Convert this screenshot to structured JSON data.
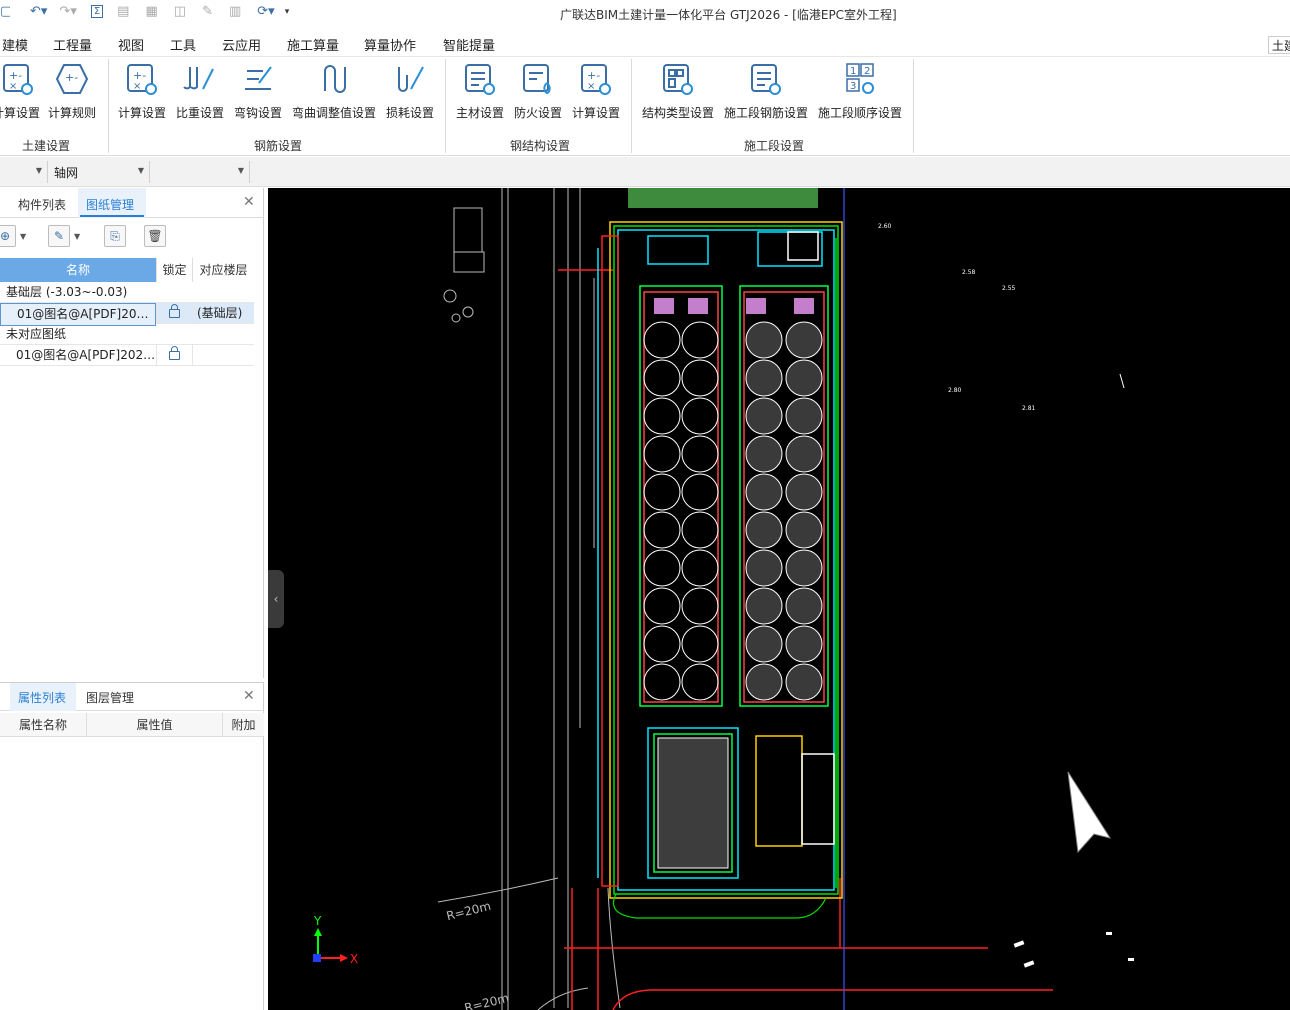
{
  "app": {
    "title": "广联达BIM土建计量一体化平台 GTJ2026 - [临港EPC室外工程]",
    "right_tab": "土建"
  },
  "menu": [
    "建模",
    "工程量",
    "视图",
    "工具",
    "云应用",
    "施工算量",
    "算量协作",
    "智能提量"
  ],
  "ribbon": {
    "groups": [
      {
        "label": "土建设置",
        "items": [
          "计算设置",
          "计算规则"
        ]
      },
      {
        "label": "钢筋设置",
        "items": [
          "计算设置",
          "比重设置",
          "弯钩设置",
          "弯曲调整值设置",
          "损耗设置"
        ]
      },
      {
        "label": "钢结构设置",
        "items": [
          "主材设置",
          "防火设置",
          "计算设置"
        ]
      },
      {
        "label": "施工段设置",
        "items": [
          "结构类型设置",
          "施工段钢筋设置",
          "施工段顺序设置"
        ]
      }
    ]
  },
  "toolbar2": {
    "dropdown1": "",
    "dropdown2": "轴网",
    "dropdown3": ""
  },
  "drawing_panel": {
    "tabs": [
      "构件列表",
      "图纸管理"
    ],
    "active_tab": "图纸管理",
    "columns": [
      "名称",
      "锁定",
      "对应楼层"
    ],
    "rows": [
      {
        "name": "基础层 (-3.03~-0.03)",
        "type": "group"
      },
      {
        "name": "01@图名@A[PDF]2026...",
        "floor": "(基础层)",
        "locked": true,
        "selected": true
      },
      {
        "name": "未对应图纸",
        "type": "group"
      },
      {
        "name": "01@图名@A[PDF]2026...",
        "floor": "",
        "locked": true
      }
    ]
  },
  "property_panel": {
    "tabs": [
      "属性列表",
      "图层管理"
    ],
    "active_tab": "属性列表",
    "columns": [
      "属性名称",
      "属性值",
      "附加"
    ]
  },
  "canvas": {
    "axis_x": "X",
    "axis_y": "Y",
    "text_r20m": "R=20m",
    "text_r20m_bottom": "R=20m"
  }
}
